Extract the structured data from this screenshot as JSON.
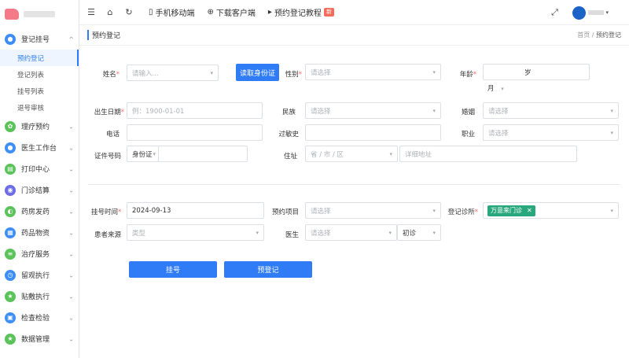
{
  "sidebar": {
    "groups": [
      {
        "label": "登记挂号",
        "icon": "person-icon",
        "color": "#3e8ef7",
        "expanded": true,
        "items": [
          {
            "label": "预约登记",
            "active": true
          },
          {
            "label": "登记列表"
          },
          {
            "label": "挂号列表"
          },
          {
            "label": "退号审核"
          }
        ]
      },
      {
        "label": "理疗预约",
        "icon": "leaf-icon",
        "color": "#5ac35a"
      },
      {
        "label": "医生工作台",
        "icon": "doctor-icon",
        "color": "#3e8ef7"
      },
      {
        "label": "打印中心",
        "icon": "print-icon",
        "color": "#5ac35a"
      },
      {
        "label": "门诊结算",
        "icon": "settle-icon",
        "color": "#6d6de8"
      },
      {
        "label": "药房发药",
        "icon": "pill-icon",
        "color": "#5ac35a"
      },
      {
        "label": "药品物资",
        "icon": "box-icon",
        "color": "#3e8ef7"
      },
      {
        "label": "治疗服务",
        "icon": "list-icon",
        "color": "#5ac35a"
      },
      {
        "label": "留观执行",
        "icon": "clock-icon",
        "color": "#3e8ef7"
      },
      {
        "label": "贴敷执行",
        "icon": "star-icon",
        "color": "#5ac35a"
      },
      {
        "label": "检查检验",
        "icon": "lab-icon",
        "color": "#3e8ef7"
      },
      {
        "label": "数据管理",
        "icon": "star-icon",
        "color": "#5ac35a"
      }
    ]
  },
  "topbar": {
    "mobile": "手机移动端",
    "download": "下载客户端",
    "tutorial": "预约登记教程",
    "new_badge": "新"
  },
  "crumb": {
    "title": "预约登记",
    "home": "首页",
    "sep": "/",
    "current": "预约登记"
  },
  "form": {
    "name_label": "姓名",
    "name_placeholder": "请输入...",
    "read_id_button": "读取身份证",
    "gender_label": "性别",
    "gender_placeholder": "请选择",
    "age_label": "年龄",
    "age_unit_year": "岁",
    "age_unit_month": "月",
    "birth_label": "出生日期",
    "birth_placeholder": "例：1900-01-01",
    "ethnicity_label": "民族",
    "ethnicity_placeholder": "请选择",
    "marriage_label": "婚姻",
    "marriage_placeholder": "请选择",
    "phone_label": "电话",
    "allergy_label": "过敏史",
    "job_label": "职业",
    "job_placeholder": "请选择",
    "idtype_label": "证件号码",
    "idtype_value": "身份证",
    "address_label": "住址",
    "region_placeholder": "省 / 市 / 区",
    "address_placeholder": "详细地址",
    "regtime_label": "挂号时间",
    "regtime_value": "2024-09-13",
    "item_label": "预约项目",
    "item_placeholder": "请选择",
    "clinic_label": "登记诊所",
    "clinic_tag": "万意来门诊",
    "source_label": "患者来源",
    "source_placeholder": "类型",
    "doctor_label": "医生",
    "doctor_placeholder": "请选择",
    "visit_type": "初诊",
    "register_button": "挂号",
    "prereg_button": "预登记"
  }
}
